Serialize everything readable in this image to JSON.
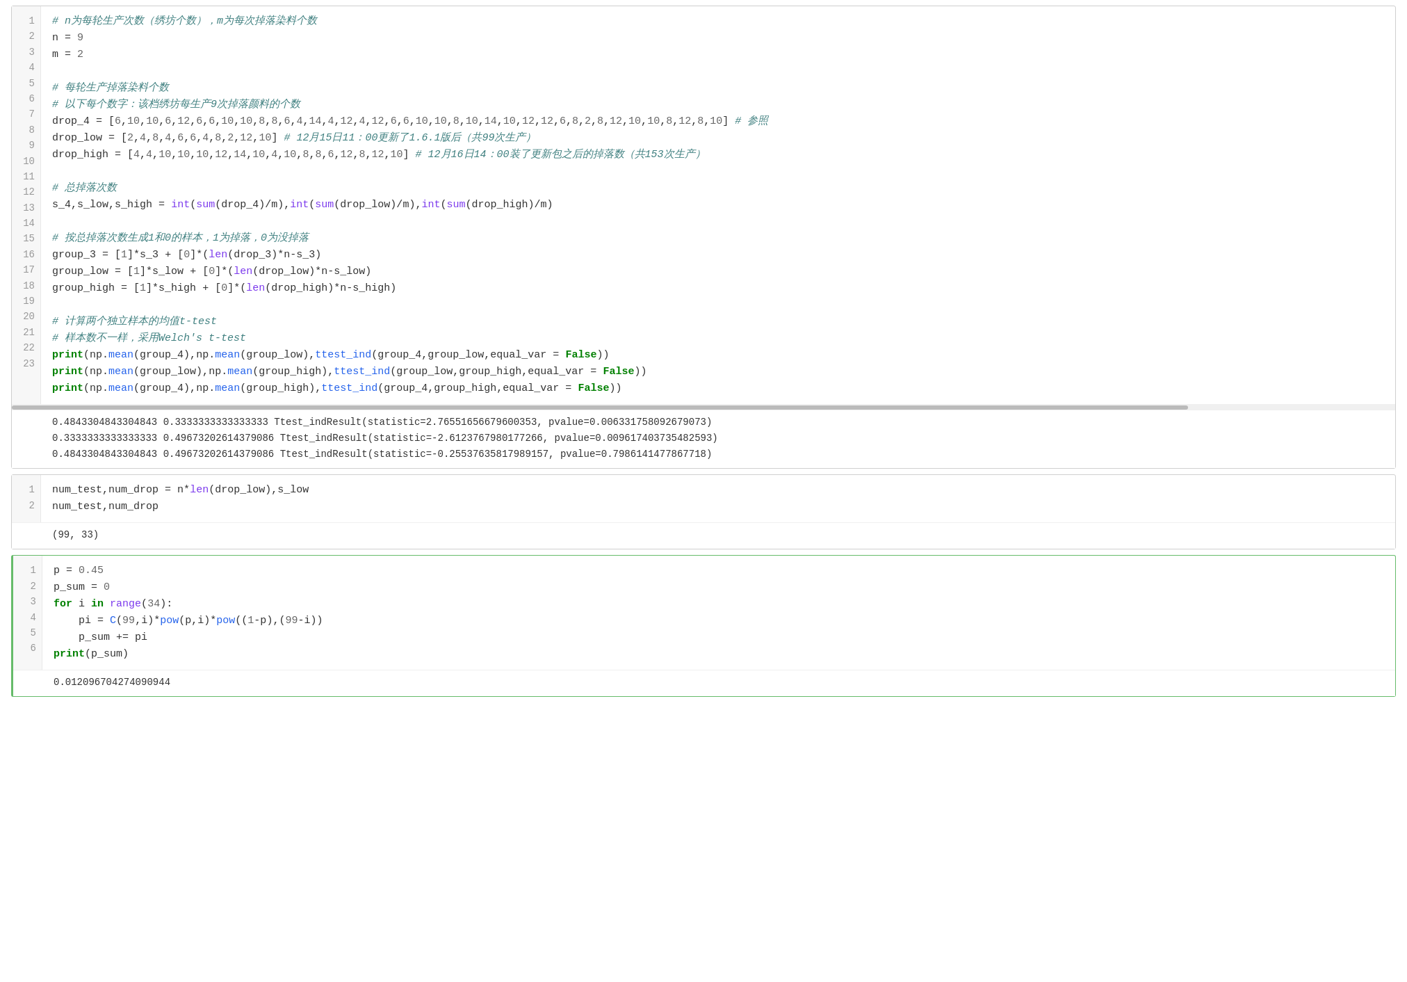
{
  "cells": [
    {
      "id": "cell-1",
      "type": "code",
      "active": false,
      "lines": [
        {
          "num": 1,
          "html": "<span class='comment'># n为每轮生产次数（绣坊个数），m为每次掉落染料个数</span>"
        },
        {
          "num": 2,
          "html": "<span class='var'>n</span> <span class='op'>=</span> <span class='number'>9</span>"
        },
        {
          "num": 3,
          "html": "<span class='var'>m</span> <span class='op'>=</span> <span class='number'>2</span>"
        },
        {
          "num": 4,
          "html": ""
        },
        {
          "num": 5,
          "html": "<span class='comment'># 每轮生产掉落染料个数</span>"
        },
        {
          "num": 6,
          "html": "<span class='comment'># 以下每个数字：该档绣坊每生产9次掉落颜料的个数</span>"
        },
        {
          "num": 7,
          "html": "<span class='var'>drop_4</span> <span class='op'>=</span> [<span class='number'>6</span>,<span class='number'>10</span>,<span class='number'>10</span>,<span class='number'>6</span>,<span class='number'>12</span>,<span class='number'>6</span>,<span class='number'>6</span>,<span class='number'>10</span>,<span class='number'>10</span>,<span class='number'>8</span>,<span class='number'>8</span>,<span class='number'>6</span>,<span class='number'>4</span>,<span class='number'>14</span>,<span class='number'>4</span>,<span class='number'>12</span>,<span class='number'>4</span>,<span class='number'>12</span>,<span class='number'>6</span>,<span class='number'>6</span>,<span class='number'>10</span>,<span class='number'>10</span>,<span class='number'>8</span>,<span class='number'>10</span>,<span class='number'>14</span>,<span class='number'>10</span>,<span class='number'>12</span>,<span class='number'>12</span>,<span class='number'>6</span>,<span class='number'>8</span>,<span class='number'>2</span>,<span class='number'>8</span>,<span class='number'>12</span>,<span class='number'>10</span>,<span class='number'>10</span>,<span class='number'>8</span>,<span class='number'>12</span>,<span class='number'>8</span>,<span class='number'>10</span>] <span class='comment'># 参照</span>"
        },
        {
          "num": 8,
          "html": "<span class='var'>drop_low</span> <span class='op'>=</span> [<span class='number'>2</span>,<span class='number'>4</span>,<span class='number'>8</span>,<span class='number'>4</span>,<span class='number'>6</span>,<span class='number'>6</span>,<span class='number'>4</span>,<span class='number'>8</span>,<span class='number'>2</span>,<span class='number'>12</span>,<span class='number'>10</span>] <span class='comment'># 12月15日11：00更新了1.6.1版后（共99次生产）</span>"
        },
        {
          "num": 9,
          "html": "<span class='var'>drop_high</span> <span class='op'>=</span> [<span class='number'>4</span>,<span class='number'>4</span>,<span class='number'>10</span>,<span class='number'>10</span>,<span class='number'>10</span>,<span class='number'>12</span>,<span class='number'>14</span>,<span class='number'>10</span>,<span class='number'>4</span>,<span class='number'>10</span>,<span class='number'>8</span>,<span class='number'>8</span>,<span class='number'>6</span>,<span class='number'>12</span>,<span class='number'>8</span>,<span class='number'>12</span>,<span class='number'>10</span>] <span class='comment'># 12月16日14：00装了更新包之后的掉落数（共153次生产）</span>"
        },
        {
          "num": 10,
          "html": ""
        },
        {
          "num": 11,
          "html": "<span class='comment'># 总掉落次数</span>"
        },
        {
          "num": 12,
          "html": "<span class='var'>s_4</span>,<span class='var'>s_low</span>,<span class='var'>s_high</span> <span class='op'>=</span> <span class='builtin'>int</span>(<span class='builtin'>sum</span>(<span class='var'>drop_4</span>)<span class='op'>/</span><span class='var'>m</span>),<span class='builtin'>int</span>(<span class='builtin'>sum</span>(<span class='var'>drop_low</span>)<span class='op'>/</span><span class='var'>m</span>),<span class='builtin'>int</span>(<span class='builtin'>sum</span>(<span class='var'>drop_high</span>)<span class='op'>/</span><span class='var'>m</span>)"
        },
        {
          "num": 13,
          "html": ""
        },
        {
          "num": 14,
          "html": "<span class='comment'># 按总掉落次数生成1和0的样本，1为掉落，0为没掉落</span>"
        },
        {
          "num": 15,
          "html": "<span class='var'>group_3</span> <span class='op'>=</span> [<span class='number'>1</span>]<span class='op'>*</span><span class='var'>s_3</span> <span class='op'>+</span> [<span class='number'>0</span>]<span class='op'>*</span>(<span class='builtin'>len</span>(<span class='var'>drop_3</span>)<span class='op'>*</span><span class='var'>n</span><span class='op'>-</span><span class='var'>s_3</span>)"
        },
        {
          "num": 16,
          "html": "<span class='var'>group_low</span> <span class='op'>=</span> [<span class='number'>1</span>]<span class='op'>*</span><span class='var'>s_low</span> <span class='op'>+</span> [<span class='number'>0</span>]<span class='op'>*</span>(<span class='builtin'>len</span>(<span class='var'>drop_low</span>)<span class='op'>*</span><span class='var'>n</span><span class='op'>-</span><span class='var'>s_low</span>)"
        },
        {
          "num": 17,
          "html": "<span class='var'>group_high</span> <span class='op'>=</span> [<span class='number'>1</span>]<span class='op'>*</span><span class='var'>s_high</span> <span class='op'>+</span> [<span class='number'>0</span>]<span class='op'>*</span>(<span class='builtin'>len</span>(<span class='var'>drop_high</span>)<span class='op'>*</span><span class='var'>n</span><span class='op'>-</span><span class='var'>s_high</span>)"
        },
        {
          "num": 18,
          "html": ""
        },
        {
          "num": 19,
          "html": "<span class='comment'># 计算两个独立样本的均值t-test</span>"
        },
        {
          "num": 20,
          "html": "<span class='comment'># 样本数不一样，采用Welch's t-test</span>"
        },
        {
          "num": 21,
          "html": "<span class='kw'>print</span>(<span class='var'>np</span>.<span class='func'>mean</span>(<span class='var'>group_4</span>),<span class='var'>np</span>.<span class='func'>mean</span>(<span class='var'>group_low</span>),<span class='func'>ttest_ind</span>(<span class='var'>group_4</span>,<span class='var'>group_low</span>,<span class='var'>equal_var</span> <span class='op'>=</span> <span class='bool'>False</span>))"
        },
        {
          "num": 22,
          "html": "<span class='kw'>print</span>(<span class='var'>np</span>.<span class='func'>mean</span>(<span class='var'>group_low</span>),<span class='var'>np</span>.<span class='func'>mean</span>(<span class='var'>group_high</span>),<span class='func'>ttest_ind</span>(<span class='var'>group_low</span>,<span class='var'>group_high</span>,<span class='var'>equal_var</span> <span class='op'>=</span> <span class='bool'>False</span>))"
        },
        {
          "num": 23,
          "html": "<span class='kw'>print</span>(<span class='var'>np</span>.<span class='func'>mean</span>(<span class='var'>group_4</span>),<span class='var'>np</span>.<span class='func'>mean</span>(<span class='var'>group_high</span>),<span class='func'>ttest_ind</span>(<span class='var'>group_4</span>,<span class='var'>group_high</span>,<span class='var'>equal_var</span> <span class='op'>=</span> <span class='bool'>False</span>))"
        }
      ],
      "output": [
        "0.4843304843304843 0.3333333333333333 Ttest_indResult(statistic=2.76551656679600353, pvalue=0.006331758092679073)",
        "0.3333333333333333 0.49673202614379086 Ttest_indResult(statistic=-2.6123767980177266, pvalue=0.009617403735482593)",
        "0.4843304843304843 0.49673202614379086 Ttest_indResult(statistic=-0.25537635817989157, pvalue=0.7986141477867718)"
      ],
      "has_scrollbar": true
    },
    {
      "id": "cell-2",
      "type": "code",
      "active": false,
      "lines": [
        {
          "num": 1,
          "html": "<span class='var'>num_test</span>,<span class='var'>num_drop</span> <span class='op'>=</span> <span class='var'>n</span><span class='op'>*</span><span class='builtin'>len</span>(<span class='var'>drop_low</span>),<span class='var'>s_low</span>"
        },
        {
          "num": 2,
          "html": "<span class='var'>num_test</span>,<span class='var'>num_drop</span>"
        }
      ],
      "output": [
        "(99, 33)"
      ],
      "has_scrollbar": false
    },
    {
      "id": "cell-3",
      "type": "code",
      "active": true,
      "lines": [
        {
          "num": 1,
          "html": "<span class='var'>p</span> <span class='op'>=</span> <span class='number'>0.45</span>"
        },
        {
          "num": 2,
          "html": "<span class='var'>p_sum</span> <span class='op'>=</span> <span class='number'>0</span>"
        },
        {
          "num": 3,
          "html": "<span class='kw'>for</span> <span class='var'>i</span> <span class='kw'>in</span> <span class='builtin'>range</span>(<span class='number'>34</span>):"
        },
        {
          "num": 4,
          "html": "    <span class='var'>pi</span> <span class='op'>=</span> <span class='func'>C</span>(<span class='number'>99</span>,<span class='var'>i</span>)<span class='op'>*</span><span class='func'>pow</span>(<span class='var'>p</span>,<span class='var'>i</span>)<span class='op'>*</span><span class='func'>pow</span>((<span class='number'>1</span><span class='op'>-</span><span class='var'>p</span>),(<span class='number'>99</span><span class='op'>-</span><span class='var'>i</span>))"
        },
        {
          "num": 5,
          "html": "    <span class='var'>p_sum</span> <span class='op'>+=</span> <span class='var'>pi</span>"
        },
        {
          "num": 6,
          "html": "<span class='kw'>print</span>(<span class='var'>p_sum</span>)"
        }
      ],
      "output": [
        "0.012096704274090944"
      ],
      "has_scrollbar": false
    }
  ]
}
